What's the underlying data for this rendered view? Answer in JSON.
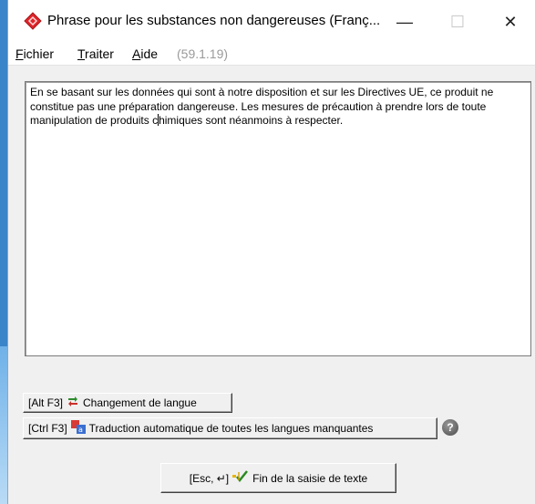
{
  "window": {
    "title": "Phrase pour les substances non dangereuses (Franç...",
    "minimize": "—",
    "maximize": "☐",
    "close": "✕"
  },
  "menu": {
    "fichier_first": "F",
    "fichier_rest": "ichier",
    "traiter_first": "T",
    "traiter_rest": "raiter",
    "aide_first": "A",
    "aide_rest": "ide",
    "version": "(59.1.19)"
  },
  "editor": {
    "text_before_caret": "En se basant sur les données qui sont à notre disposition et sur les Directives UE, ce produit ne constitue pas une préparation dangereuse. Les mesures de précaution à prendre lors de toute manipulation de produits c",
    "text_after_caret": "himiques sont néanmoins à respecter."
  },
  "buttons": {
    "language_change": "[Alt F3]",
    "language_change_label": "Changement de langue",
    "auto_translate": "[Ctrl F3]",
    "auto_translate_label": "Traduction automatique de toutes les langues manquantes",
    "end_input_key": "[Esc, ↵]",
    "end_input_label": "Fin de la saisie de texte",
    "help": "?"
  },
  "icons": {
    "app": "red-diamond-icon",
    "language": "language-swap-icon",
    "translate": "translate-icon",
    "finish": "checkmark-icon",
    "help": "help-icon"
  },
  "colors": {
    "app_icon": "#e0262b",
    "desktop": "#3a84c9"
  }
}
